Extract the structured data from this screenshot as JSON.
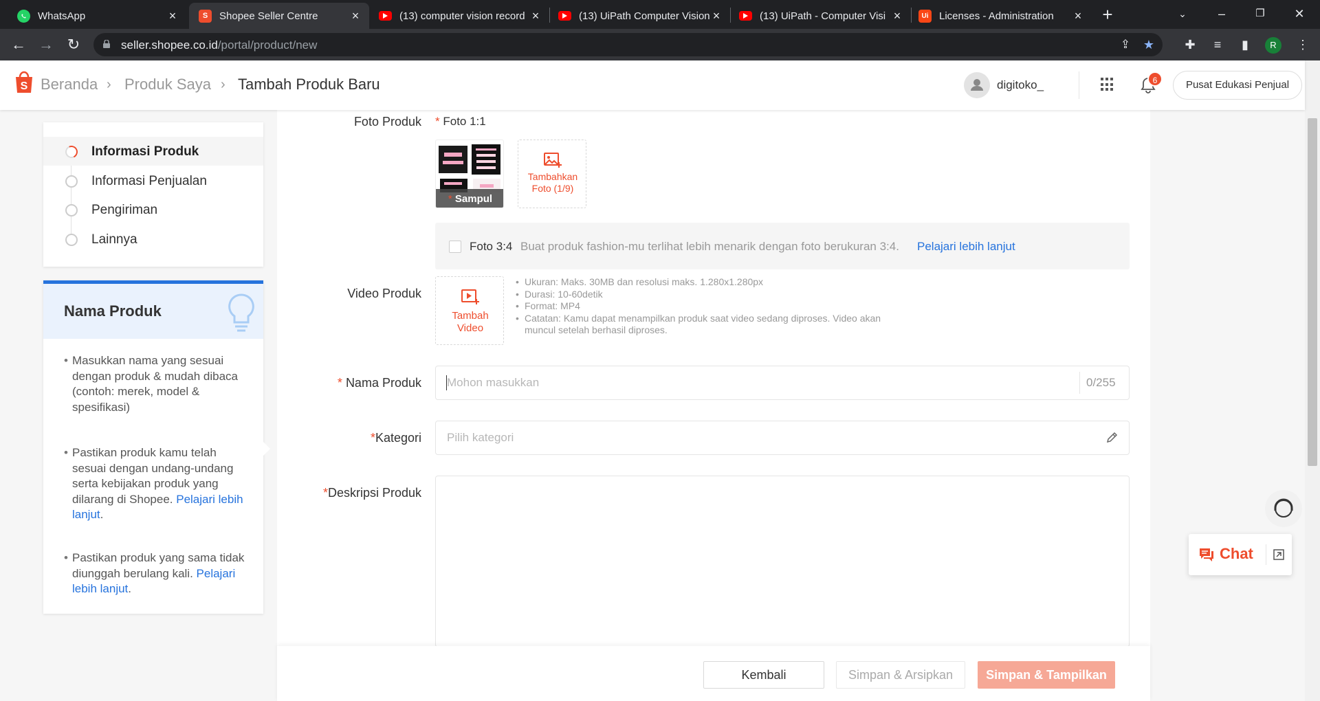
{
  "browser": {
    "tabs": [
      {
        "title": "WhatsApp",
        "icon": "whatsapp-icon",
        "color": "#25d366"
      },
      {
        "title": "Shopee Seller Centre",
        "icon": "shopee-icon",
        "color": "#ee4d2d"
      },
      {
        "title": "(13) computer vision record",
        "icon": "youtube-icon",
        "color": "#ff0000"
      },
      {
        "title": "(13) UiPath Computer Vision",
        "icon": "youtube-icon",
        "color": "#ff0000"
      },
      {
        "title": "(13) UiPath - Computer Visi",
        "icon": "youtube-icon",
        "color": "#ff0000"
      },
      {
        "title": "Licenses - Administration",
        "icon": "uipath-icon",
        "color": "#fa4616"
      }
    ],
    "uipath_icon_letters": "Ui",
    "url_host": "seller.shopee.co.id",
    "url_path": "/portal/product/new",
    "profile_initial": "R"
  },
  "header": {
    "breadcrumb": [
      "Beranda",
      "Produk Saya",
      "Tambah Produk Baru"
    ],
    "username": "digitoko_",
    "notification_count": "6",
    "edu_button": "Pusat Edukasi Penjual"
  },
  "steps": [
    {
      "label": "Informasi Produk",
      "active": true
    },
    {
      "label": "Informasi Penjualan",
      "active": false
    },
    {
      "label": "Pengiriman",
      "active": false
    },
    {
      "label": "Lainnya",
      "active": false
    }
  ],
  "tips": {
    "title": "Nama Produk",
    "items": [
      {
        "text": "Masukkan nama yang sesuai dengan produk & mudah dibaca (contoh: merek, model & spesifikasi)",
        "link": ""
      },
      {
        "text": "Pastikan produk kamu telah sesuai dengan undang-undang serta kebijakan produk yang dilarang di Shopee. ",
        "link": "Pelajari lebih lanjut"
      },
      {
        "text": "Pastikan produk yang sama tidak diunggah berulang kali. ",
        "link": "Pelajari lebih lanjut"
      }
    ]
  },
  "form": {
    "foto_produk_label": "Foto Produk",
    "foto_ratio_label": "Foto 1:1",
    "cover_label": "Sampul",
    "add_photo_line1": "Tambahkan",
    "add_photo_line2": "Foto (1/9)",
    "foto34_label": "Foto 3:4",
    "foto34_text": "Buat produk fashion-mu terlihat lebih menarik dengan foto berukuran 3:4.",
    "foto34_link": "Pelajari lebih lanjut",
    "video_label": "Video Produk",
    "add_video_line1": "Tambah",
    "add_video_line2": "Video",
    "video_requirements": [
      "Ukuran: Maks. 30MB dan resolusi maks. 1.280x1.280px",
      "Durasi: 10-60detik",
      "Format: MP4",
      "Catatan: Kamu dapat menampilkan produk saat video sedang diproses. Video akan muncul setelah berhasil diproses."
    ],
    "nama_label": "Nama Produk",
    "nama_placeholder": "Mohon masukkan",
    "nama_count": "0/255",
    "kategori_label": "Kategori",
    "kategori_placeholder": "Pilih kategori",
    "deskripsi_label": "Deskripsi Produk",
    "required_mark": "*"
  },
  "actions": {
    "back": "Kembali",
    "archive": "Simpan & Arsipkan",
    "publish": "Simpan & Tampilkan"
  },
  "chat": {
    "label": "Chat"
  },
  "colors": {
    "brand": "#ee4d2d",
    "link": "#2673dd"
  }
}
